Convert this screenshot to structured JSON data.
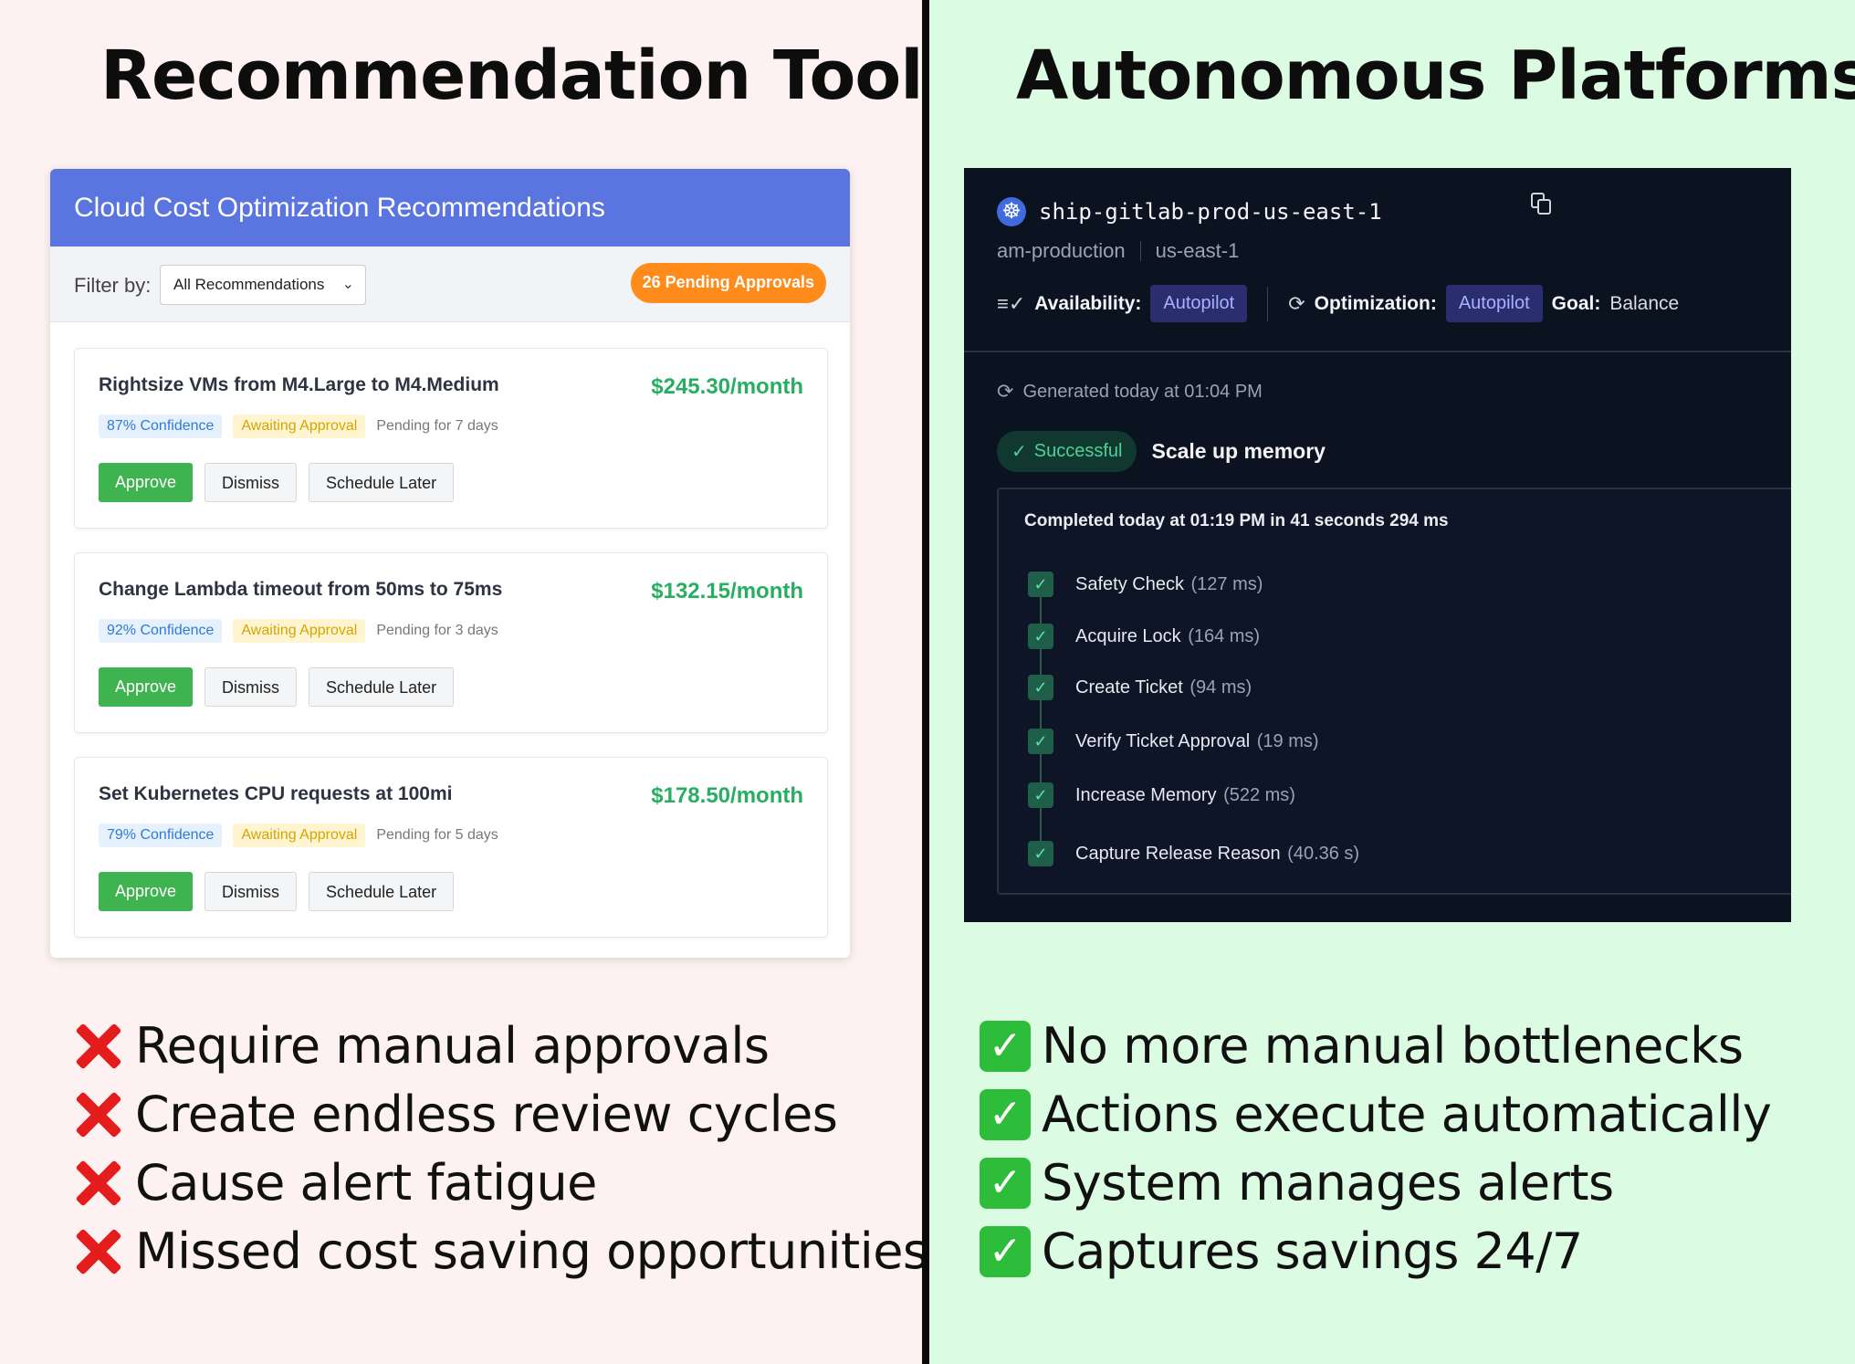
{
  "left": {
    "heading": "Recommendation Tools",
    "panel": {
      "title": "Cloud Cost Optimization Recommendations",
      "filter_label": "Filter by:",
      "filter_value": "All Recommendations",
      "pending_badge": "26 Pending Approvals",
      "items": [
        {
          "title": "Rightsize VMs from M4.Large to M4.Medium",
          "amount": "$245.30/month",
          "confidence": "87% Confidence",
          "status": "Awaiting Approval",
          "pending": "Pending for 7 days"
        },
        {
          "title": "Change Lambda timeout from 50ms to 75ms",
          "amount": "$132.15/month",
          "confidence": "92% Confidence",
          "status": "Awaiting Approval",
          "pending": "Pending for 3 days"
        },
        {
          "title": "Set Kubernetes CPU requests at 100mi",
          "amount": "$178.50/month",
          "confidence": "79% Confidence",
          "status": "Awaiting Approval",
          "pending": "Pending for 5 days"
        }
      ],
      "buttons": {
        "approve": "Approve",
        "dismiss": "Dismiss",
        "schedule": "Schedule Later"
      }
    },
    "bullets": [
      "Require manual approvals",
      "Create endless review cycles",
      "Cause alert fatigue",
      "Missed cost saving opportunities"
    ]
  },
  "right": {
    "heading": "Autonomous Platforms",
    "panel": {
      "cluster": "ship-gitlab-prod-us-east-1",
      "env": "am-production",
      "region": "us-east-1",
      "availability_label": "Availability:",
      "availability_value": "Autopilot",
      "optimization_label": "Optimization:",
      "optimization_value": "Autopilot",
      "goal_label": "Goal:",
      "goal_value": "Balance",
      "generated": "Generated today at 01:04 PM",
      "status": "Successful",
      "action": "Scale up memory",
      "completed": "Completed today at 01:19 PM in 41 seconds 294 ms",
      "steps": [
        {
          "name": "Safety Check",
          "time": "(127 ms)"
        },
        {
          "name": "Acquire Lock",
          "time": "(164 ms)"
        },
        {
          "name": "Create Ticket",
          "time": "(94 ms)"
        },
        {
          "name": "Verify Ticket Approval",
          "time": "(19 ms)"
        },
        {
          "name": "Increase Memory",
          "time": "(522 ms)"
        },
        {
          "name": "Capture Release Reason",
          "time": "(40.36 s)"
        }
      ]
    },
    "bullets": [
      "No more manual bottlenecks",
      "Actions execute automatically",
      "System manages alerts",
      "Captures savings 24/7"
    ]
  },
  "icons": {
    "x_mark": "cross-mark-icon",
    "check_mark": "check-mark-button-icon",
    "kubernetes": "kubernetes-icon",
    "copy": "copy-icon"
  },
  "colors": {
    "left_bg": "#fdf2f1",
    "right_bg": "#dcfbe3",
    "panel_header": "#5a74e0",
    "pending_badge": "#ff8c1a",
    "amount": "#27ae60",
    "approve": "#3fb34f",
    "dark_panel": "#0b1220",
    "autopilot_pill": "#2b2e6e",
    "success": "#4fd19a"
  }
}
